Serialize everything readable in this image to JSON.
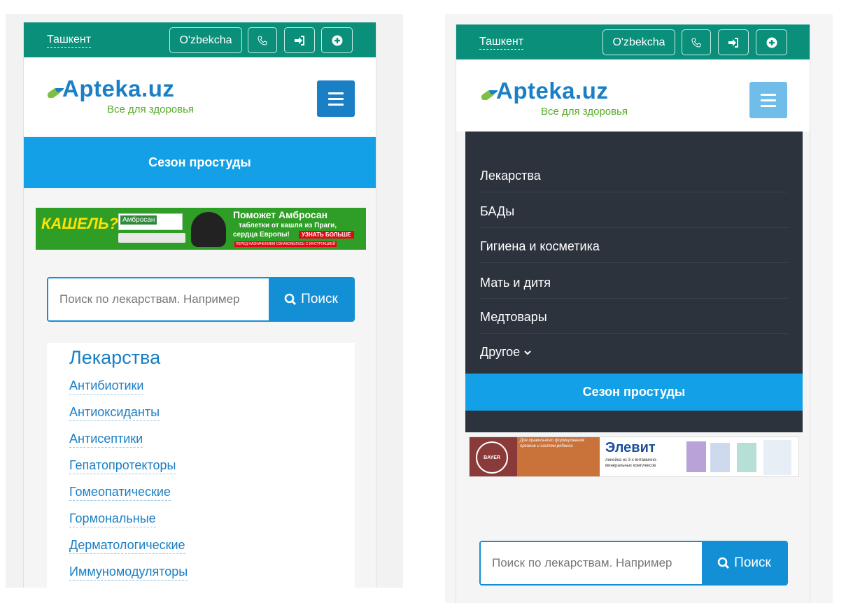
{
  "left": {
    "city": "Ташкент",
    "lang": "O'zbekcha",
    "logo": {
      "name": "Apteka.uz",
      "tagline": "Все для здоровья"
    },
    "season_banner": "Сезон простуды",
    "ad": {
      "headline": "КАШЕЛЬ?",
      "product": "Амбросан",
      "title": "Поможет Амбросан",
      "line1": "таблетки от кашля из Праги,",
      "line2": "сердца Европы!",
      "cta": "УЗНАТЬ БОЛЬШЕ",
      "disclaimer": "ПЕРЕД НАЗНАЧЕНИЕМ ОЗНАКОМЬТЕСЬ С ИНСТРУКЦИЕЙ"
    },
    "search": {
      "placeholder": "Поиск по лекарствам. Например",
      "button": "Поиск"
    },
    "categories": {
      "title": "Лекарства",
      "items": [
        "Антибиотики",
        "Антиоксиданты",
        "Антисептики",
        "Гепатопротекторы",
        "Гомеопатические",
        "Гормональные",
        "Дерматологические",
        "Иммуномодуляторы"
      ]
    }
  },
  "right": {
    "city": "Ташкент",
    "lang": "O'zbekcha",
    "logo": {
      "name": "Apteka.uz",
      "tagline": "Все для здоровья"
    },
    "menu": [
      "Лекарства",
      "БАДы",
      "Гигиена и косметика",
      "Мать и дитя",
      "Медтовары",
      "Другое"
    ],
    "season_banner": "Сезон простуды",
    "ad": {
      "brand": "BAYER",
      "product": "Элевит",
      "tagline1": "Для правильного формирования",
      "tagline2": "органов и систем ребенка",
      "desc1": "линейка из 3-х витаминно-",
      "desc2": "минеральных комплексов"
    },
    "search": {
      "placeholder": "Поиск по лекарствам. Например",
      "button": "Поиск"
    }
  },
  "colors": {
    "topbar": "#0a8f7b",
    "brand_blue": "#1a7fc4",
    "season": "#14a0e6",
    "menu_bg": "#2c333d"
  },
  "icons": [
    "phone-icon",
    "sign-in-icon",
    "plus-circle-icon",
    "menu-icon",
    "search-icon",
    "chevron-down-icon"
  ]
}
